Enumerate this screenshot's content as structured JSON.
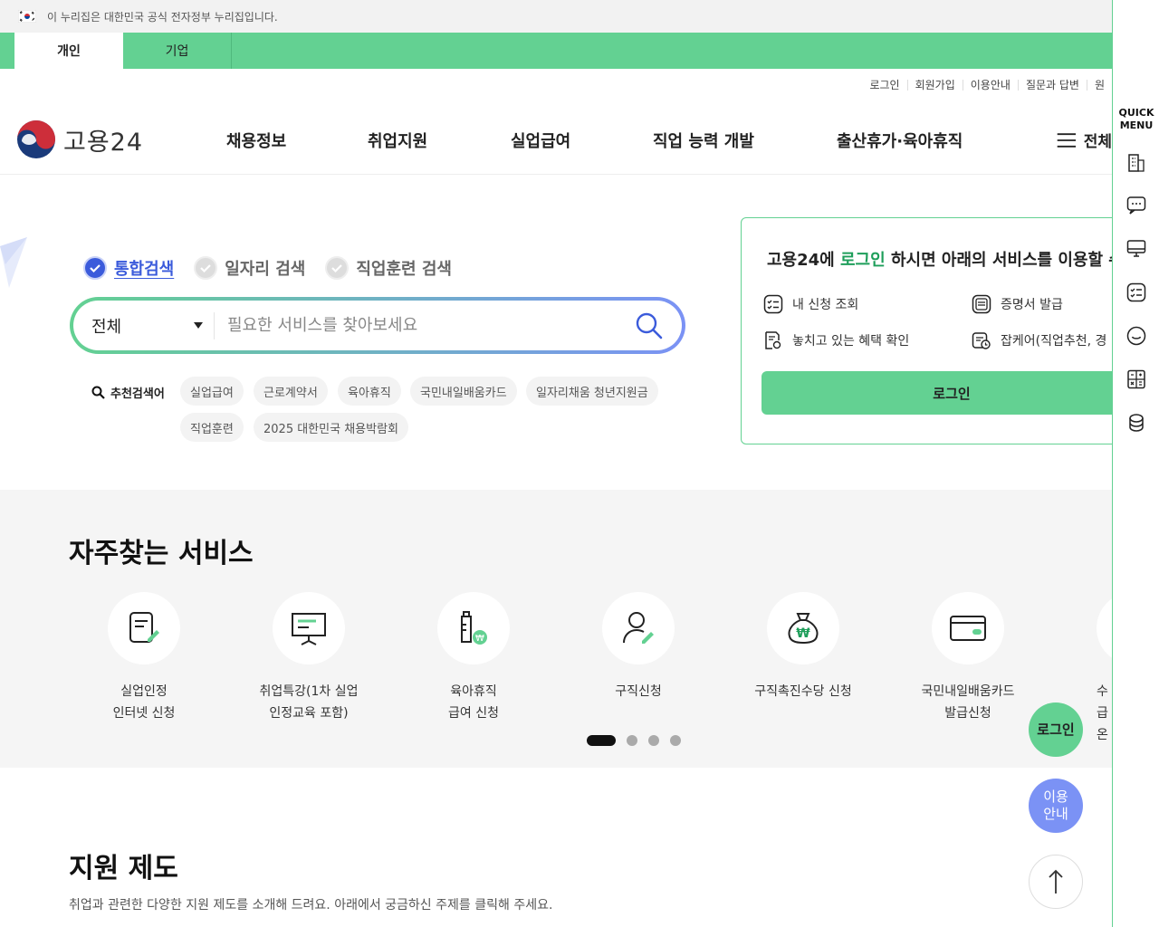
{
  "gov_banner": {
    "text": "이 누리집은 대한민국 공식 전자정부 누리집입니다."
  },
  "top_tabs": [
    {
      "label": "개인"
    },
    {
      "label": "기업"
    }
  ],
  "util_links": [
    "로그인",
    "회원가입",
    "이용안내",
    "질문과 답변",
    "원"
  ],
  "logo": {
    "text": "고용24"
  },
  "gnb": [
    "채용정보",
    "취업지원",
    "실업급여",
    "직업 능력 개발",
    "출산휴가·육아휴직"
  ],
  "all_menu": {
    "label": "전체"
  },
  "search": {
    "tabs": [
      "통합검색",
      "일자리 검색",
      "직업훈련 검색"
    ],
    "category": "전체",
    "placeholder": "필요한 서비스를 찾아보세요",
    "reco_label": "추천검색어",
    "keywords": [
      "실업급여",
      "근로계약서",
      "육아휴직",
      "국민내일배움카드",
      "일자리채움 청년지원금",
      "직업훈련",
      "2025 대한민국 채용박람회"
    ]
  },
  "login_box": {
    "title_pre": "고용24에 ",
    "title_hl": "로그인",
    "title_post": " 하시면 아래의 서비스를 이용할 수",
    "services": [
      "내 신청 조회",
      "증명서 발급",
      "놓치고 있는 혜택 확인",
      "잡케어(직업추천, 경"
    ],
    "button": "로그인"
  },
  "freq": {
    "title": "자주찾는 서비스",
    "items": [
      "실업인정\n인터넷 신청",
      "취업특강(1차 실업\n인정교육 포함)",
      "육아휴직\n급여 신청",
      "구직신청",
      "구직촉진수당 신청",
      "국민내일배움카드\n발급신청",
      "수급\n온"
    ]
  },
  "support": {
    "title": "지원 제도",
    "desc": "취업과 관련한 다양한 지원 제도를 소개해 드려요. 아래에서 궁금하신 주제를 클릭해 주세요."
  },
  "quick_menu": {
    "title_1": "QUICK",
    "title_2": "MENU"
  },
  "fabs": {
    "login": "로그인",
    "guide_1": "이용",
    "guide_2": "안내"
  },
  "colors": {
    "brand_green": "#63d192",
    "accent_blue": "#3b5bdb",
    "accent_purple": "#7b92f5",
    "logo_red": "#cd2e3a",
    "logo_navy": "#1a3a7a"
  }
}
